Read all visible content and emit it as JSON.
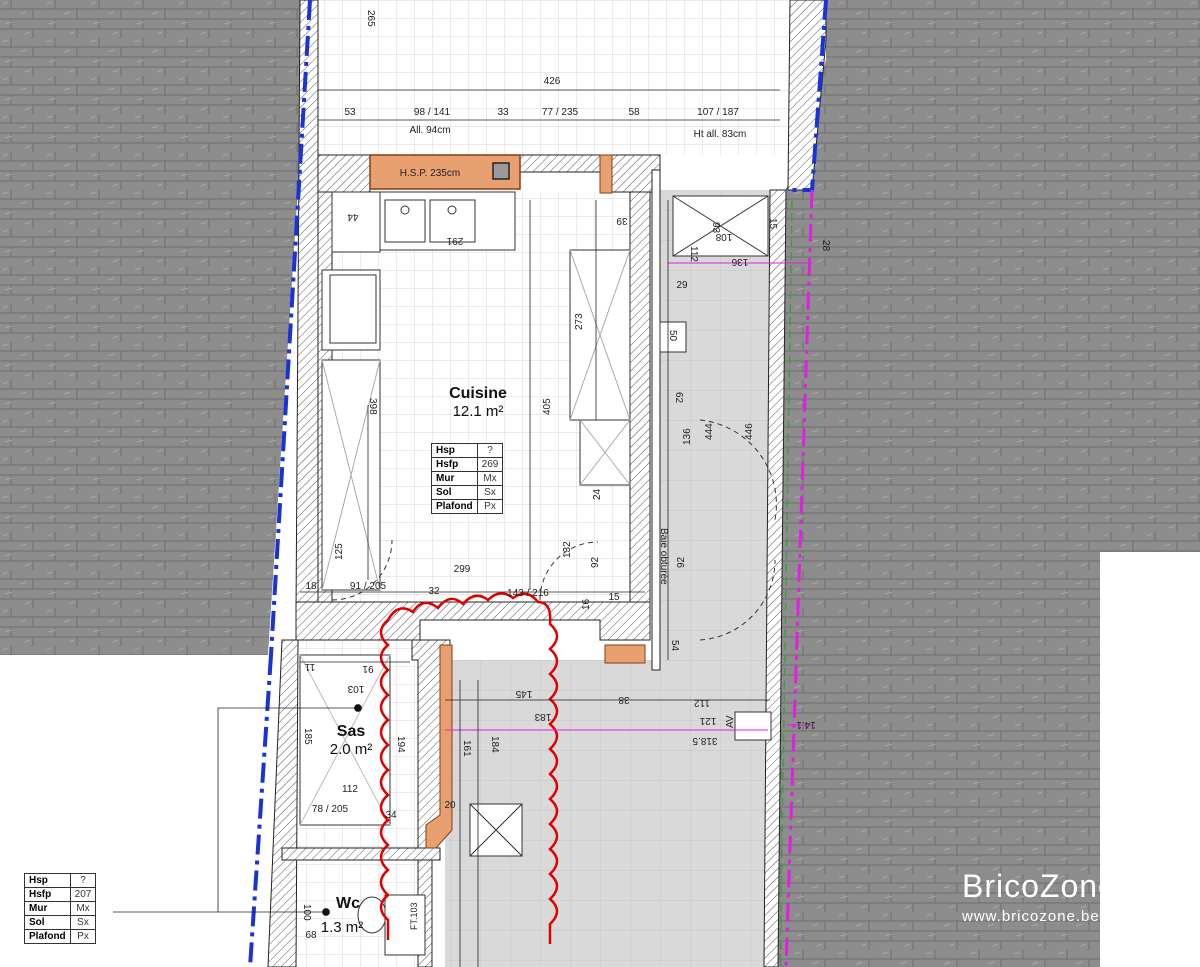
{
  "rooms": {
    "kitchen": {
      "name": "Cuisine",
      "area": "12.1 m²"
    },
    "sas": {
      "name": "Sas",
      "area": "2.0 m²"
    },
    "wc": {
      "name": "Wc",
      "area": "1.3 m²"
    }
  },
  "tables": {
    "kitchen": [
      {
        "k": "Hsp",
        "v": "?"
      },
      {
        "k": "Hsfp",
        "v": "269"
      },
      {
        "k": "Mur",
        "v": "Mx"
      },
      {
        "k": "Sol",
        "v": "Sx"
      },
      {
        "k": "Plafond",
        "v": "Px"
      }
    ],
    "wc": [
      {
        "k": "Hsp",
        "v": "?"
      },
      {
        "k": "Hsfp",
        "v": "207"
      },
      {
        "k": "Mur",
        "v": "Mx"
      },
      {
        "k": "Sol",
        "v": "Sx"
      },
      {
        "k": "Plafond",
        "v": "Px"
      }
    ]
  },
  "annotations": {
    "hsp_label": "H.S.P. 235cm",
    "baie": "Baie obturée",
    "ht_all_1": "All. 94cm",
    "ht_all_2": "Ht all. 83cm",
    "av": "AV",
    "ft": "FT.103"
  },
  "dims": {
    "d265": "265",
    "d426": "426",
    "d53": "53",
    "d98_141": "98 / 141",
    "d33": "33",
    "d77_235": "77 / 235",
    "d58": "58",
    "d107_187": "107 / 187",
    "d44": "44",
    "d291": "291",
    "d39": "39",
    "d93": "93",
    "d108": "108",
    "d15": "15",
    "d112a": "112",
    "d136": "136",
    "d28": "28",
    "d29": "29",
    "d273": "273",
    "d50": "50",
    "d398": "398",
    "d405": "405",
    "d62": "62",
    "d444": "444",
    "d446": "446",
    "d136b": "136",
    "d24": "24",
    "d125": "125",
    "d132": "132",
    "d92a": "92",
    "d92b": "92",
    "d299": "299",
    "d18": "18",
    "d91_205": "91 / 205",
    "d32": "32",
    "d143_216": "143 / 216",
    "d16": "16",
    "d15b": "15",
    "d54": "54",
    "d11": "11",
    "d91": "91",
    "d103": "103",
    "d145": "145",
    "d38": "38",
    "d112b": "112",
    "d183": "183",
    "d121": "121",
    "d185": "185",
    "d194": "194",
    "d161": "161",
    "d184": "184",
    "d318": "318.5",
    "d141": "14.1",
    "d112c": "112",
    "d78_205": "78 / 205",
    "d34": "34",
    "d20": "20",
    "d100": "100",
    "d68": "68"
  },
  "watermark": {
    "brand": "BricoZone",
    "url": "www.bricozone.be"
  },
  "colors": {
    "wall_hatch": "#8c8c8c",
    "boundary": "#1a33d6",
    "revision": "#e00000",
    "magenta": "#e020e0",
    "brick": "#e8a070"
  }
}
